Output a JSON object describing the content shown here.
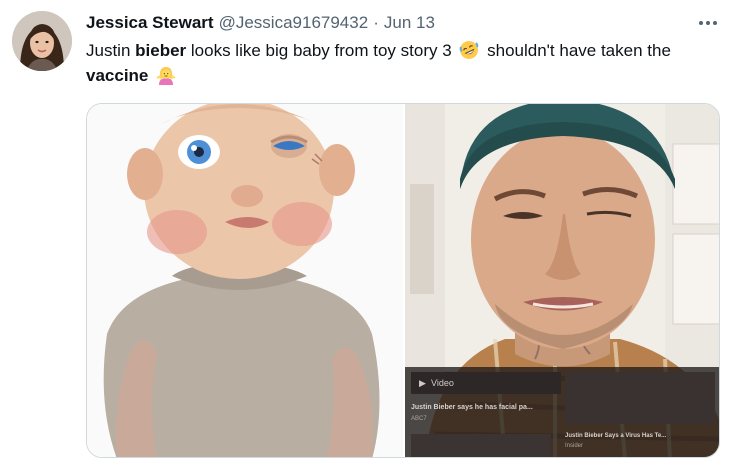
{
  "tweet": {
    "author_name": "Jessica Stewart",
    "handle": "@Jessica91679432",
    "separator": "·",
    "date": "Jun 13",
    "text_parts": {
      "p1": "Justin ",
      "b1": "bieber",
      "p2": " looks like big baby from toy story 3 ",
      "p3": " shouldn't have taken the ",
      "b2": "vaccine"
    },
    "emoji_1": "rolling-on-floor-laughing-emoji",
    "emoji_2": "woman-shrugging-emoji"
  },
  "media": {
    "right_overlay": {
      "video_label": "Video",
      "caption_1": "Justin Bieber says he has facial pa...",
      "source_1": "ABC7",
      "caption_2": "Justin Bieber Says a Virus Has Te...",
      "source_2": "Insider"
    }
  },
  "colors": {
    "text_primary": "#0f1419",
    "text_secondary": "#536471",
    "border": "#cfd9de"
  }
}
